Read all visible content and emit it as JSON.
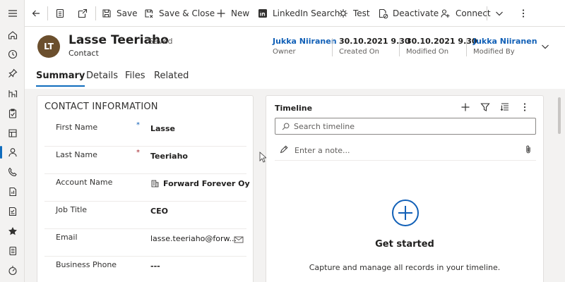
{
  "rail": {
    "items": [
      "menu-icon",
      "home-icon",
      "recent-icon",
      "pin-icon",
      "sales-icon",
      "task-icon",
      "document-icon",
      "contact-icon",
      "phone-icon",
      "report-icon",
      "checklist-icon",
      "star-icon",
      "notebook-icon",
      "target-icon"
    ],
    "active_index": 7
  },
  "toolbar": {
    "save": "Save",
    "save_close": "Save & Close",
    "new": "New",
    "linkedin": "LinkedIn Search",
    "test": "Test",
    "deactivate": "Deactivate",
    "connect": "Connect"
  },
  "header": {
    "initials": "LT",
    "name": "Lasse Teeriaho",
    "saved": "- Saved",
    "entity": "Contact",
    "fields": [
      {
        "value": "Jukka Niiranen",
        "label": "Owner"
      },
      {
        "value": "30.10.2021 9.30",
        "label": "Created On"
      },
      {
        "value": "30.10.2021 9.30",
        "label": "Modified On"
      },
      {
        "value": "Jukka Niiranen",
        "label": "Modified By"
      }
    ]
  },
  "tabs": [
    "Summary",
    "Details",
    "Files",
    "Related"
  ],
  "contact": {
    "section_title": "CONTACT INFORMATION",
    "rows": [
      {
        "label": "First Name",
        "required": "*",
        "value": "Lasse"
      },
      {
        "label": "Last Name",
        "required": "*",
        "value": "Teeriaho"
      },
      {
        "label": "Account Name",
        "required": "",
        "value": "Forward Forever Oy"
      },
      {
        "label": "Job Title",
        "required": "",
        "value": "CEO"
      },
      {
        "label": "Email",
        "required": "",
        "value": "lasse.teeriaho@forw..."
      },
      {
        "label": "Business Phone",
        "required": "",
        "value": "---"
      }
    ]
  },
  "timeline": {
    "title": "Timeline",
    "search_placeholder": "Search timeline",
    "note_placeholder": "Enter a note...",
    "empty_title": "Get started",
    "empty_sub": "Capture and manage all records in your timeline."
  },
  "colors": {
    "accent": "#0f6cbd",
    "link": "#1160b7",
    "avatar": "#6b4f2d",
    "required": "#a4262c"
  }
}
